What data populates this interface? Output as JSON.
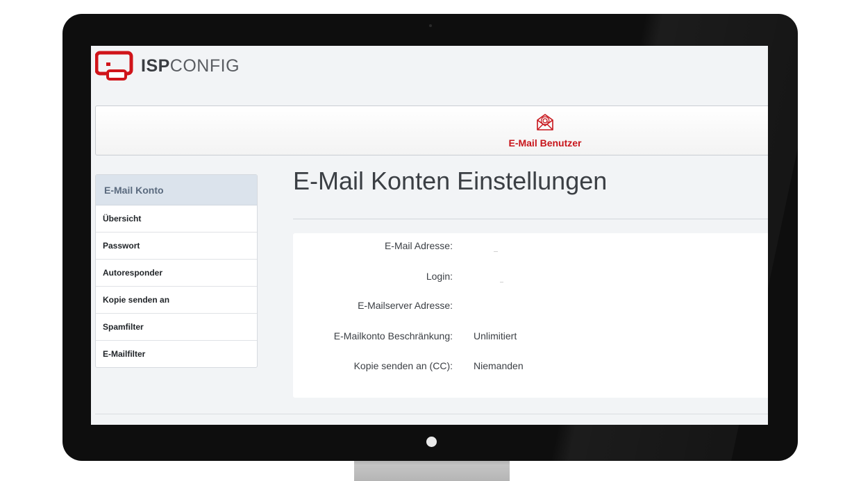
{
  "app": {
    "logo_bold": "ISP",
    "logo_light": "CONFIG"
  },
  "module": {
    "label": "E-Mail Benutzer",
    "icon": "envelope-at-icon",
    "color": "#c8151b"
  },
  "sidebar": {
    "header": "E-Mail Konto",
    "items": [
      {
        "label": "Übersicht"
      },
      {
        "label": "Passwort"
      },
      {
        "label": "Autoresponder"
      },
      {
        "label": "Kopie senden an"
      },
      {
        "label": "Spamfilter"
      },
      {
        "label": "E-Mailfilter"
      }
    ]
  },
  "main": {
    "title": "E-Mail Konten Einstellungen",
    "fields": [
      {
        "label": "E-Mail Adresse:",
        "value": ""
      },
      {
        "label": "Login:",
        "value": ""
      },
      {
        "label": "E-Mailserver Adresse:",
        "value": ""
      },
      {
        "label": "E-Mailkonto Beschränkung:",
        "value": "Unlimitiert"
      },
      {
        "label": "Kopie senden an (CC):",
        "value": "Niemanden"
      }
    ]
  }
}
